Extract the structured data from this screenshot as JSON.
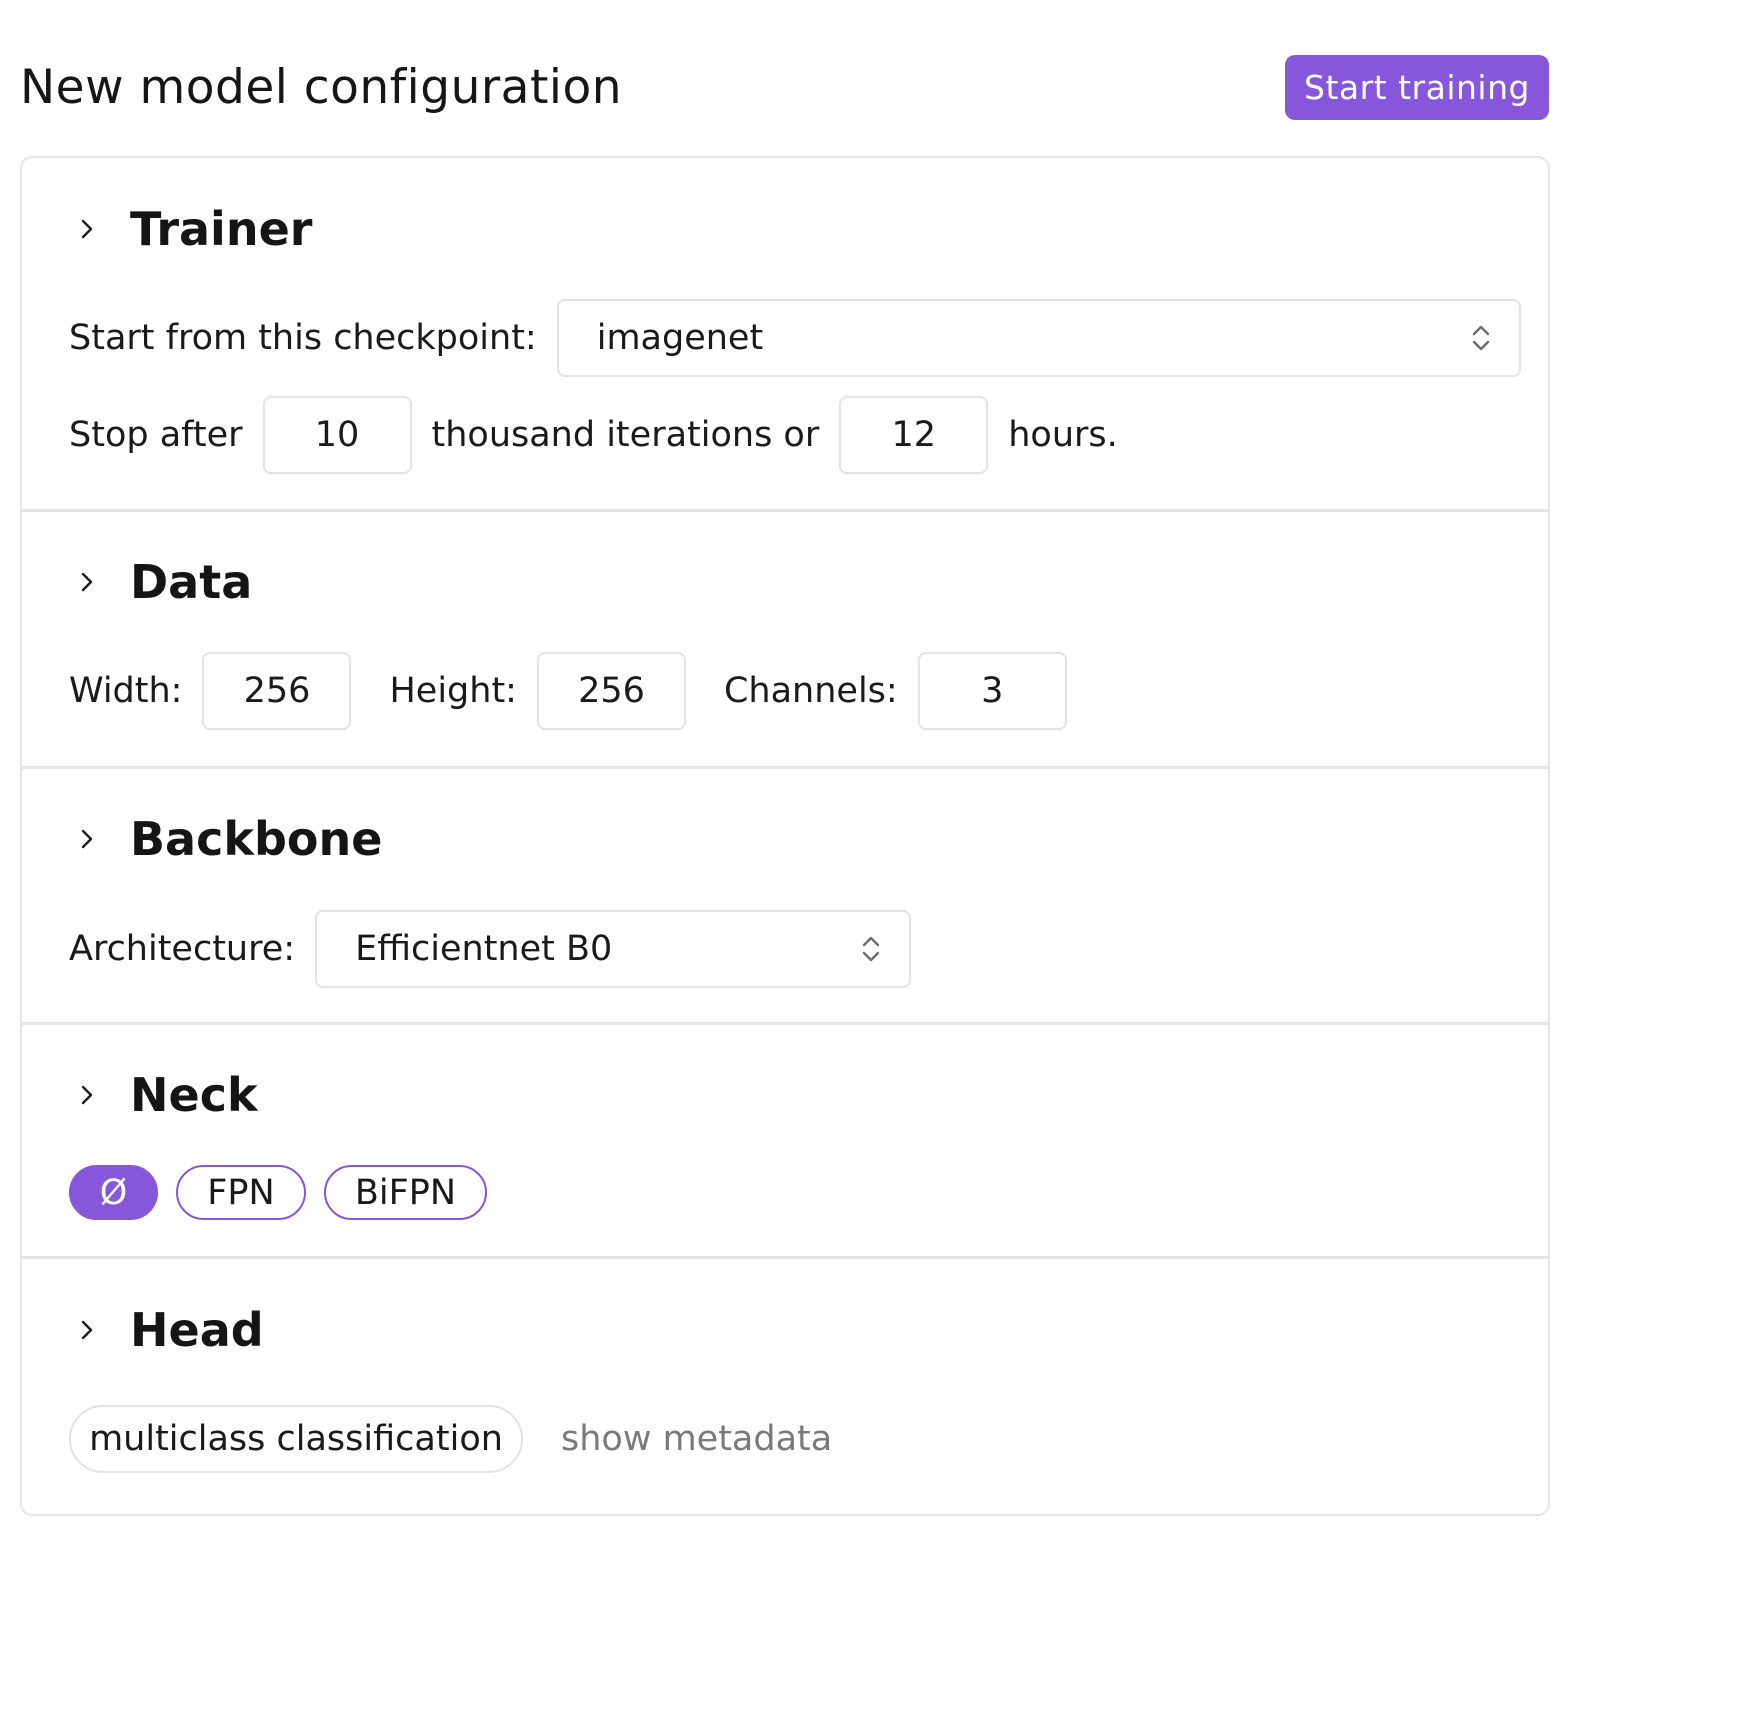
{
  "header": {
    "title": "New model configuration",
    "start_training_label": "Start training",
    "accent_color": "#8757db"
  },
  "sections": {
    "trainer": {
      "title": "Trainer",
      "chevron_icon": "chevron-right-icon",
      "checkpoint_label": "Start from this checkpoint:",
      "checkpoint_value": "imagenet",
      "stop_after_label": "Stop after",
      "iterations_value": "10",
      "iterations_suffix": "thousand iterations or",
      "hours_value": "12",
      "hours_suffix": "hours."
    },
    "data": {
      "title": "Data",
      "chevron_icon": "chevron-right-icon",
      "width_label": "Width:",
      "width_value": "256",
      "height_label": "Height:",
      "height_value": "256",
      "channels_label": "Channels:",
      "channels_value": "3"
    },
    "backbone": {
      "title": "Backbone",
      "chevron_icon": "chevron-right-icon",
      "architecture_label": "Architecture:",
      "architecture_value": "Efficientnet B0"
    },
    "neck": {
      "title": "Neck",
      "chevron_icon": "chevron-right-icon",
      "options": [
        {
          "label": "Ø",
          "selected": true
        },
        {
          "label": "FPN",
          "selected": false
        },
        {
          "label": "BiFPN",
          "selected": false
        }
      ]
    },
    "head": {
      "title": "Head",
      "chevron_icon": "chevron-right-icon",
      "head_type": "multiclass classification",
      "show_metadata_label": "show metadata"
    }
  }
}
